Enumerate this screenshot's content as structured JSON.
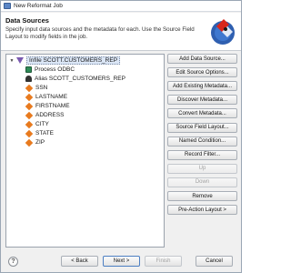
{
  "window": {
    "title": "New Reformat Job"
  },
  "header": {
    "heading": "Data Sources",
    "description": "Specify input data sources and the metadata for each. Use the Source Field Layout to modify fields in the job."
  },
  "tree": {
    "root": {
      "label": "Infile SCOTT.CUSTOMERS_REP",
      "icon": "infile-icon",
      "expanded": true
    },
    "children": [
      {
        "label": "Process ODBC",
        "icon": "process-icon"
      },
      {
        "label": "Alias SCOTT_CUSTOMERS_REP",
        "icon": "alias-icon"
      },
      {
        "label": "SSN",
        "icon": "field-icon"
      },
      {
        "label": "LASTNAME",
        "icon": "field-icon"
      },
      {
        "label": "FIRSTNAME",
        "icon": "field-icon"
      },
      {
        "label": "ADDRESS",
        "icon": "field-icon"
      },
      {
        "label": "CITY",
        "icon": "field-icon"
      },
      {
        "label": "STATE",
        "icon": "field-icon"
      },
      {
        "label": "ZIP",
        "icon": "field-icon"
      }
    ]
  },
  "buttons": [
    {
      "label": "Add Data Source...",
      "enabled": true
    },
    {
      "label": "Edit Source Options...",
      "enabled": true
    },
    {
      "label": "Add Existing Metadata...",
      "enabled": true
    },
    {
      "label": "Discover Metadata...",
      "enabled": true
    },
    {
      "label": "Convert Metadata...",
      "enabled": true
    },
    {
      "label": "Source Field Layout...",
      "enabled": true
    },
    {
      "label": "Named Condition...",
      "enabled": true
    },
    {
      "label": "Record Filter...",
      "enabled": true
    },
    {
      "label": "Up",
      "enabled": false
    },
    {
      "label": "Down",
      "enabled": false
    },
    {
      "label": "Remove",
      "enabled": true
    },
    {
      "label": "Pre-Action Layout >",
      "enabled": true
    }
  ],
  "footer": {
    "help_symbol": "?",
    "back_label": "< Back",
    "next_label": "Next >",
    "finish_label": "Finish",
    "cancel_label": "Cancel"
  }
}
